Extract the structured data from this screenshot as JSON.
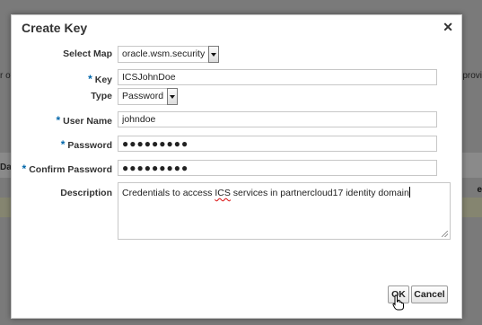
{
  "background": {
    "left_text_1": "r of e",
    "left_text_2": "Da",
    "right_text_1": "provi",
    "right_text_2": "e"
  },
  "dialog": {
    "title": "Create Key",
    "close_icon": "close-icon",
    "select_map": {
      "label": "Select Map",
      "value": "oracle.wsm.security"
    },
    "key": {
      "label": "Key",
      "required_mark": "*",
      "value": "ICSJohnDoe"
    },
    "type": {
      "label": "Type",
      "value": "Password"
    },
    "user_name": {
      "label": "User Name",
      "required_mark": "*",
      "value": "johndoe"
    },
    "password": {
      "label": "Password",
      "required_mark": "*",
      "value": "●●●●●●●●●"
    },
    "confirm_password": {
      "label": "Confirm Password",
      "required_mark": "*",
      "value": "●●●●●●●●●"
    },
    "description": {
      "label": "Description",
      "value_before": "Credentials to access ",
      "value_misspelled": "ICS",
      "value_after": " services in partnercloud17 identity domain"
    },
    "ok_label": "OK",
    "cancel_label": "Cancel"
  },
  "colors": {
    "required_mark": "#0066aa",
    "overlay": "#7a7a7a"
  }
}
